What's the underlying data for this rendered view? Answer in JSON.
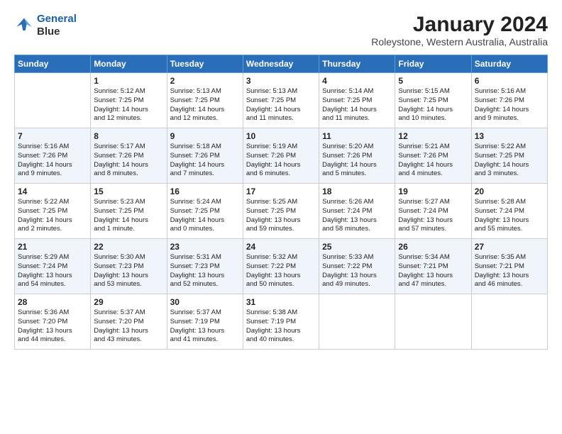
{
  "header": {
    "logo_line1": "General",
    "logo_line2": "Blue",
    "month_year": "January 2024",
    "location": "Roleystone, Western Australia, Australia"
  },
  "weekdays": [
    "Sunday",
    "Monday",
    "Tuesday",
    "Wednesday",
    "Thursday",
    "Friday",
    "Saturday"
  ],
  "weeks": [
    [
      {
        "day": "",
        "text": ""
      },
      {
        "day": "1",
        "text": "Sunrise: 5:12 AM\nSunset: 7:25 PM\nDaylight: 14 hours\nand 12 minutes."
      },
      {
        "day": "2",
        "text": "Sunrise: 5:13 AM\nSunset: 7:25 PM\nDaylight: 14 hours\nand 12 minutes."
      },
      {
        "day": "3",
        "text": "Sunrise: 5:13 AM\nSunset: 7:25 PM\nDaylight: 14 hours\nand 11 minutes."
      },
      {
        "day": "4",
        "text": "Sunrise: 5:14 AM\nSunset: 7:25 PM\nDaylight: 14 hours\nand 11 minutes."
      },
      {
        "day": "5",
        "text": "Sunrise: 5:15 AM\nSunset: 7:25 PM\nDaylight: 14 hours\nand 10 minutes."
      },
      {
        "day": "6",
        "text": "Sunrise: 5:16 AM\nSunset: 7:26 PM\nDaylight: 14 hours\nand 9 minutes."
      }
    ],
    [
      {
        "day": "7",
        "text": "Sunrise: 5:16 AM\nSunset: 7:26 PM\nDaylight: 14 hours\nand 9 minutes."
      },
      {
        "day": "8",
        "text": "Sunrise: 5:17 AM\nSunset: 7:26 PM\nDaylight: 14 hours\nand 8 minutes."
      },
      {
        "day": "9",
        "text": "Sunrise: 5:18 AM\nSunset: 7:26 PM\nDaylight: 14 hours\nand 7 minutes."
      },
      {
        "day": "10",
        "text": "Sunrise: 5:19 AM\nSunset: 7:26 PM\nDaylight: 14 hours\nand 6 minutes."
      },
      {
        "day": "11",
        "text": "Sunrise: 5:20 AM\nSunset: 7:26 PM\nDaylight: 14 hours\nand 5 minutes."
      },
      {
        "day": "12",
        "text": "Sunrise: 5:21 AM\nSunset: 7:26 PM\nDaylight: 14 hours\nand 4 minutes."
      },
      {
        "day": "13",
        "text": "Sunrise: 5:22 AM\nSunset: 7:25 PM\nDaylight: 14 hours\nand 3 minutes."
      }
    ],
    [
      {
        "day": "14",
        "text": "Sunrise: 5:22 AM\nSunset: 7:25 PM\nDaylight: 14 hours\nand 2 minutes."
      },
      {
        "day": "15",
        "text": "Sunrise: 5:23 AM\nSunset: 7:25 PM\nDaylight: 14 hours\nand 1 minute."
      },
      {
        "day": "16",
        "text": "Sunrise: 5:24 AM\nSunset: 7:25 PM\nDaylight: 14 hours\nand 0 minutes."
      },
      {
        "day": "17",
        "text": "Sunrise: 5:25 AM\nSunset: 7:25 PM\nDaylight: 13 hours\nand 59 minutes."
      },
      {
        "day": "18",
        "text": "Sunrise: 5:26 AM\nSunset: 7:24 PM\nDaylight: 13 hours\nand 58 minutes."
      },
      {
        "day": "19",
        "text": "Sunrise: 5:27 AM\nSunset: 7:24 PM\nDaylight: 13 hours\nand 57 minutes."
      },
      {
        "day": "20",
        "text": "Sunrise: 5:28 AM\nSunset: 7:24 PM\nDaylight: 13 hours\nand 55 minutes."
      }
    ],
    [
      {
        "day": "21",
        "text": "Sunrise: 5:29 AM\nSunset: 7:24 PM\nDaylight: 13 hours\nand 54 minutes."
      },
      {
        "day": "22",
        "text": "Sunrise: 5:30 AM\nSunset: 7:23 PM\nDaylight: 13 hours\nand 53 minutes."
      },
      {
        "day": "23",
        "text": "Sunrise: 5:31 AM\nSunset: 7:23 PM\nDaylight: 13 hours\nand 52 minutes."
      },
      {
        "day": "24",
        "text": "Sunrise: 5:32 AM\nSunset: 7:22 PM\nDaylight: 13 hours\nand 50 minutes."
      },
      {
        "day": "25",
        "text": "Sunrise: 5:33 AM\nSunset: 7:22 PM\nDaylight: 13 hours\nand 49 minutes."
      },
      {
        "day": "26",
        "text": "Sunrise: 5:34 AM\nSunset: 7:21 PM\nDaylight: 13 hours\nand 47 minutes."
      },
      {
        "day": "27",
        "text": "Sunrise: 5:35 AM\nSunset: 7:21 PM\nDaylight: 13 hours\nand 46 minutes."
      }
    ],
    [
      {
        "day": "28",
        "text": "Sunrise: 5:36 AM\nSunset: 7:20 PM\nDaylight: 13 hours\nand 44 minutes."
      },
      {
        "day": "29",
        "text": "Sunrise: 5:37 AM\nSunset: 7:20 PM\nDaylight: 13 hours\nand 43 minutes."
      },
      {
        "day": "30",
        "text": "Sunrise: 5:37 AM\nSunset: 7:19 PM\nDaylight: 13 hours\nand 41 minutes."
      },
      {
        "day": "31",
        "text": "Sunrise: 5:38 AM\nSunset: 7:19 PM\nDaylight: 13 hours\nand 40 minutes."
      },
      {
        "day": "",
        "text": ""
      },
      {
        "day": "",
        "text": ""
      },
      {
        "day": "",
        "text": ""
      }
    ]
  ]
}
